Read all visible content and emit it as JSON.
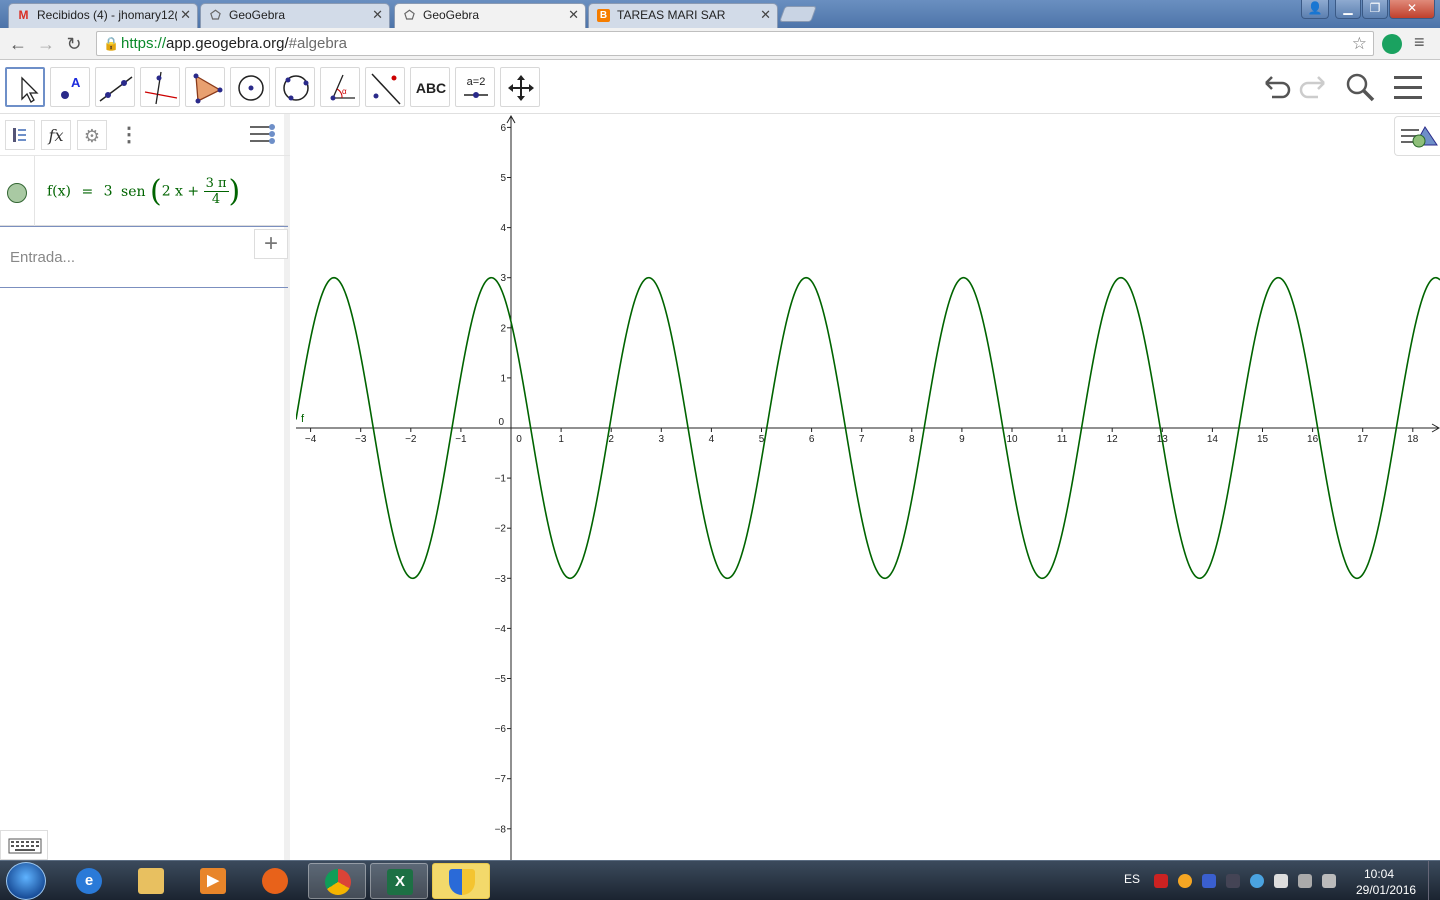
{
  "browser": {
    "tabs": [
      {
        "title": "Recibidos (4) - jhomary12(",
        "favicon": "gmail-icon",
        "active": false
      },
      {
        "title": "GeoGebra",
        "favicon": "geogebra-icon",
        "active": false
      },
      {
        "title": "GeoGebra",
        "favicon": "geogebra-icon",
        "active": true
      },
      {
        "title": "TAREAS MARI SAR",
        "favicon": "blogger-icon",
        "active": false
      }
    ],
    "url_scheme": "https://",
    "url_host": "app.geogebra.org/",
    "url_path": "#algebra"
  },
  "toolbar": {
    "tools": [
      "move-tool",
      "point-tool",
      "line-tool",
      "perpendicular-line-tool",
      "polygon-tool",
      "circle-tool",
      "conic-tool",
      "angle-tool",
      "reflect-tool",
      "text-tool",
      "slider-tool",
      "move-graphics-view-tool"
    ],
    "text_tool_label": "ABC",
    "slider_tool_label": "a=2"
  },
  "algebra": {
    "fx_label": "𝑓x",
    "formula": {
      "lhs": "f(x)",
      "eq": "=",
      "coef": "3",
      "func": "sen",
      "inner": "2 x +",
      "frac_num": "3 π",
      "frac_den": "4"
    },
    "input_placeholder": "Entrada..."
  },
  "graphics": {
    "curve_label": "f",
    "x_ticks": [
      "−4",
      "−3",
      "−2",
      "−1",
      "0",
      "1",
      "2",
      "3",
      "4",
      "5",
      "6",
      "7",
      "8",
      "9",
      "10",
      "11",
      "12",
      "13",
      "14",
      "15",
      "16",
      "17",
      "18"
    ],
    "y_ticks": [
      "6",
      "5",
      "4",
      "3",
      "2",
      "1",
      "0",
      "−1",
      "−2",
      "−3",
      "−4",
      "−5",
      "−6",
      "−7",
      "−8"
    ],
    "curve_color": "#006400",
    "function": {
      "amplitude": 3,
      "frequency": 2,
      "phase_num": 3,
      "phase_den": 4
    },
    "x_range": [
      -4.3,
      18.5
    ],
    "y_range": [
      -8.6,
      6.2
    ]
  },
  "taskbar": {
    "apps": [
      "ie-icon",
      "file-explorer-icon",
      "media-player-icon",
      "firefox-icon",
      "chrome-icon",
      "excel-icon",
      "security-shield-icon"
    ],
    "language": "ES",
    "time": "10:04",
    "date": "29/01/2016"
  }
}
